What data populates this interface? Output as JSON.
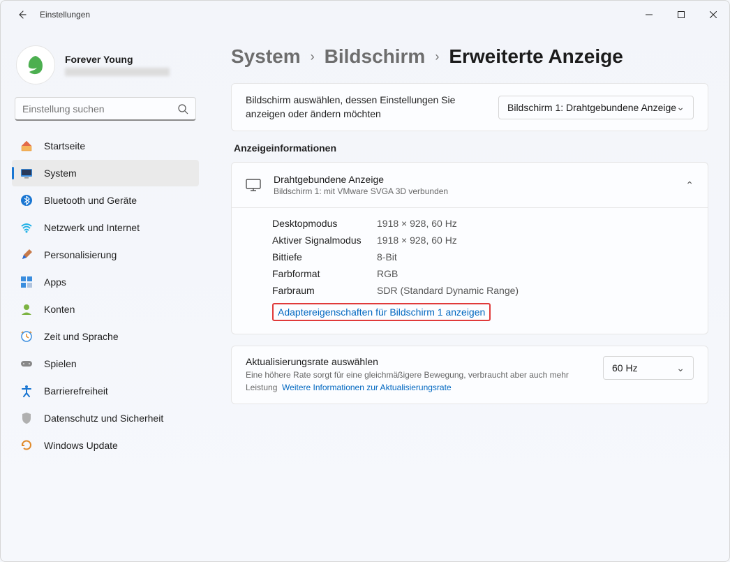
{
  "window": {
    "title": "Einstellungen"
  },
  "user": {
    "name": "Forever Young"
  },
  "search": {
    "placeholder": "Einstellung suchen"
  },
  "sidebar": {
    "items": [
      {
        "label": "Startseite"
      },
      {
        "label": "System"
      },
      {
        "label": "Bluetooth und Geräte"
      },
      {
        "label": "Netzwerk und Internet"
      },
      {
        "label": "Personalisierung"
      },
      {
        "label": "Apps"
      },
      {
        "label": "Konten"
      },
      {
        "label": "Zeit und Sprache"
      },
      {
        "label": "Spielen"
      },
      {
        "label": "Barrierefreiheit"
      },
      {
        "label": "Datenschutz und Sicherheit"
      },
      {
        "label": "Windows Update"
      }
    ]
  },
  "breadcrumb": {
    "a": "System",
    "b": "Bildschirm",
    "c": "Erweiterte Anzeige"
  },
  "select_display": {
    "text": "Bildschirm auswählen, dessen Einstellungen Sie anzeigen oder ändern möchten",
    "dropdown": "Bildschirm 1: Drahtgebundene Anzeige"
  },
  "info": {
    "section_title": "Anzeigeinformationen",
    "header_title": "Drahtgebundene Anzeige",
    "header_sub": "Bildschirm 1: mit VMware SVGA 3D verbunden",
    "rows": [
      {
        "k": "Desktopmodus",
        "v": "1918 × 928, 60 Hz"
      },
      {
        "k": "Aktiver Signalmodus",
        "v": "1918 × 928, 60 Hz"
      },
      {
        "k": "Bittiefe",
        "v": "8-Bit"
      },
      {
        "k": "Farbformat",
        "v": "RGB"
      },
      {
        "k": "Farbraum",
        "v": "SDR (Standard Dynamic Range)"
      }
    ],
    "adapter_link": "Adaptereigenschaften für Bildschirm 1 anzeigen"
  },
  "refresh": {
    "title": "Aktualisierungsrate auswählen",
    "sub": "Eine höhere Rate sorgt für eine gleichmäßigere Bewegung, verbraucht aber auch mehr Leistung",
    "link": "Weitere Informationen zur Aktualisierungsrate",
    "value": "60 Hz"
  }
}
